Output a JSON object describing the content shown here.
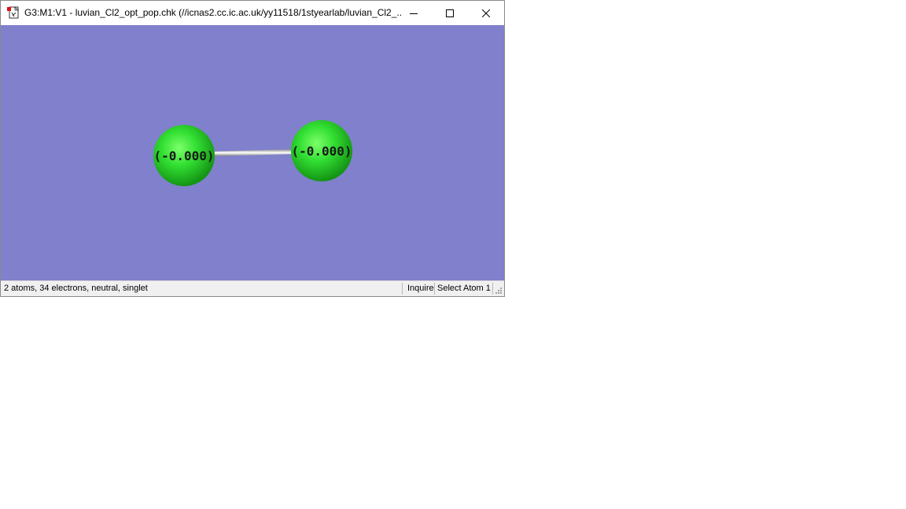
{
  "window": {
    "title": "G3:M1:V1 - luvian_Cl2_opt_pop.chk (//icnas2.cc.ic.ac.uk/yy11518/1styearlab/luvian_Cl2_...",
    "icons": {
      "app": "gaussview-document-icon",
      "minimize": "minimize-icon",
      "maximize": "maximize-icon",
      "close": "close-icon"
    }
  },
  "viewport": {
    "background_color": "#8080cc",
    "atom_color": "#33dd33",
    "bond_color": "#c0c0c0",
    "atoms": [
      {
        "element": "Cl",
        "label": "(-0.000)"
      },
      {
        "element": "Cl",
        "label": "(-0.000)"
      }
    ]
  },
  "statusbar": {
    "info": "2 atoms, 34 electrons, neutral, singlet",
    "mode": "Inquire",
    "action": "Select Atom 1"
  }
}
